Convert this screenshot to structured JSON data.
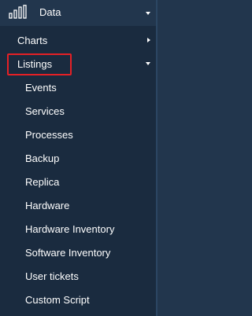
{
  "menu": {
    "header": {
      "label": "Data",
      "icon": "bar-chart-icon"
    },
    "charts": {
      "label": "Charts"
    },
    "listings": {
      "label": "Listings",
      "items": [
        {
          "label": "Events"
        },
        {
          "label": "Services"
        },
        {
          "label": "Processes"
        },
        {
          "label": "Backup"
        },
        {
          "label": "Replica"
        },
        {
          "label": "Hardware"
        },
        {
          "label": "Hardware Inventory"
        },
        {
          "label": "Software Inventory"
        },
        {
          "label": "User tickets"
        },
        {
          "label": "Custom Script"
        }
      ]
    }
  },
  "colors": {
    "header_bg": "#22364d",
    "panel_bg": "#1a2b3f",
    "text": "#ffffff",
    "highlight_border": "#e52025"
  }
}
